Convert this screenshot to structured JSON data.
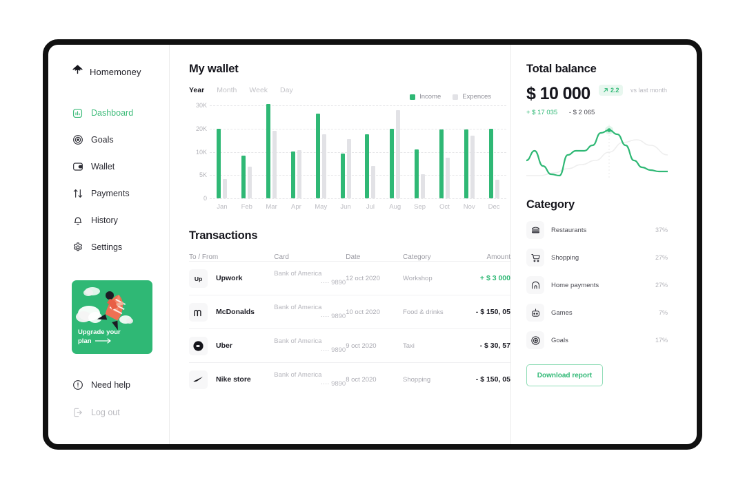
{
  "brand": {
    "name": "Homemoney",
    "icon": "home-arrow-icon"
  },
  "sidebar": {
    "items": [
      {
        "label": "Dashboard",
        "icon": "chart-bar-icon",
        "active": true
      },
      {
        "label": "Goals",
        "icon": "target-icon",
        "active": false
      },
      {
        "label": "Wallet",
        "icon": "wallet-icon",
        "active": false
      },
      {
        "label": "Payments",
        "icon": "arrows-updown-icon",
        "active": false
      },
      {
        "label": "History",
        "icon": "bell-icon",
        "active": false
      },
      {
        "label": "Settings",
        "icon": "gear-icon",
        "active": false
      }
    ],
    "upgrade": {
      "line1": "Upgrade your",
      "line2": "plan",
      "arrow": "→"
    },
    "bottom": [
      {
        "label": "Need help",
        "icon": "info-circle-icon",
        "muted": false
      },
      {
        "label": "Log out",
        "icon": "logout-icon",
        "muted": true
      }
    ]
  },
  "main": {
    "wallet_title": "My wallet",
    "tabs": [
      {
        "label": "Year",
        "active": true
      },
      {
        "label": "Month",
        "active": false
      },
      {
        "label": "Week",
        "active": false
      },
      {
        "label": "Day",
        "active": false
      }
    ],
    "legend": [
      {
        "label": "Income",
        "color": "#2fb875"
      },
      {
        "label": "Expences",
        "color": "#e2e2e6"
      }
    ],
    "transactions_title": "Transactions",
    "table": {
      "columns": [
        "To / From",
        "Card",
        "Date",
        "Category",
        "Amount"
      ],
      "rows": [
        {
          "logo": "upwork-logo",
          "name": "Upwork",
          "bank": "Bank of America",
          "card": "···· 9890",
          "date": "12 oct 2020",
          "category": "Workshop",
          "amount": "+ $ 3 000",
          "positive": true
        },
        {
          "logo": "mcdonalds-logo",
          "name": "McDonalds",
          "bank": "Bank of America",
          "card": "···· 9890",
          "date": "10 oct 2020",
          "category": "Food & drinks",
          "amount": "- $ 150, 05",
          "positive": false
        },
        {
          "logo": "uber-logo",
          "name": "Uber",
          "bank": "Bank of America",
          "card": "···· 9890",
          "date": "9 oct 2020",
          "category": "Taxi",
          "amount": "- $ 30, 57",
          "positive": false
        },
        {
          "logo": "nike-logo",
          "name": "Nike store",
          "bank": "Bank of America",
          "card": "···· 9890",
          "date": "8 oct 2020",
          "category": "Shopping",
          "amount": "- $ 150, 05",
          "positive": false
        }
      ]
    }
  },
  "right": {
    "balance_title": "Total balance",
    "balance_amount": "$ 10 000",
    "badge_value": "2.2",
    "badge_arrow": "↗",
    "vs_label": "vs last month",
    "delta_positive": "+ $ 17 035",
    "delta_negative": "- $ 2 065",
    "category_title": "Category",
    "categories": [
      {
        "name": "Restaurants",
        "pct_label": "37%",
        "fill": 53,
        "icon": "burger-icon"
      },
      {
        "name": "Shopping",
        "pct_label": "27%",
        "fill": 43,
        "icon": "cart-icon"
      },
      {
        "name": "Home payments",
        "pct_label": "27%",
        "fill": 43,
        "icon": "home-icon"
      },
      {
        "name": "Games",
        "pct_label": "7%",
        "fill": 29,
        "icon": "robot-icon"
      },
      {
        "name": "Goals",
        "pct_label": "17%",
        "fill": 29,
        "icon": "target-icon"
      }
    ],
    "download_label": "Download report"
  },
  "chart_data": {
    "type": "bar",
    "title": "My wallet",
    "xlabel": "",
    "ylabel": "",
    "grid": true,
    "legend_position": "top-right",
    "categories": [
      "Jan",
      "Feb",
      "Mar",
      "Apr",
      "May",
      "Jun",
      "Jul",
      "Aug",
      "Sep",
      "Oct",
      "Nov",
      "Dec"
    ],
    "y_ticks": [
      0,
      5000,
      10000,
      20000,
      30000
    ],
    "y_tick_labels": [
      "0",
      "5K",
      "10K",
      "20K",
      "30K"
    ],
    "ylim": [
      0,
      32000
    ],
    "series": [
      {
        "name": "Income",
        "color": "#2fb875",
        "values": [
          20000,
          9200,
          30500,
          10300,
          26500,
          9700,
          17500,
          20000,
          11000,
          19500,
          19700,
          20000
        ]
      },
      {
        "name": "Expences",
        "color": "#e2e2e6",
        "values": [
          4200,
          6800,
          19000,
          10800,
          17500,
          15500,
          7000,
          28000,
          5200,
          8700,
          17000,
          4000
        ]
      }
    ]
  },
  "sparkline_data": {
    "type": "line",
    "series": [
      {
        "name": "balance",
        "color": "#2fb875",
        "points": [
          [
            0,
            52
          ],
          [
            12,
            38
          ],
          [
            24,
            60
          ],
          [
            36,
            72
          ],
          [
            48,
            74
          ],
          [
            60,
            44
          ],
          [
            72,
            38
          ],
          [
            84,
            38
          ],
          [
            96,
            30
          ],
          [
            108,
            12
          ],
          [
            120,
            8
          ],
          [
            132,
            14
          ],
          [
            144,
            30
          ],
          [
            156,
            52
          ],
          [
            168,
            62
          ],
          [
            180,
            66
          ],
          [
            192,
            68
          ],
          [
            205,
            68
          ]
        ]
      },
      {
        "name": "previous",
        "color": "#eeeeee",
        "points": [
          [
            0,
            74
          ],
          [
            20,
            74
          ],
          [
            40,
            70
          ],
          [
            60,
            64
          ],
          [
            80,
            58
          ],
          [
            100,
            52
          ],
          [
            120,
            40
          ],
          [
            140,
            26
          ],
          [
            160,
            22
          ],
          [
            180,
            30
          ],
          [
            205,
            44
          ]
        ]
      }
    ],
    "marker": {
      "x": 120,
      "y": 8
    },
    "vline_x": 120
  }
}
